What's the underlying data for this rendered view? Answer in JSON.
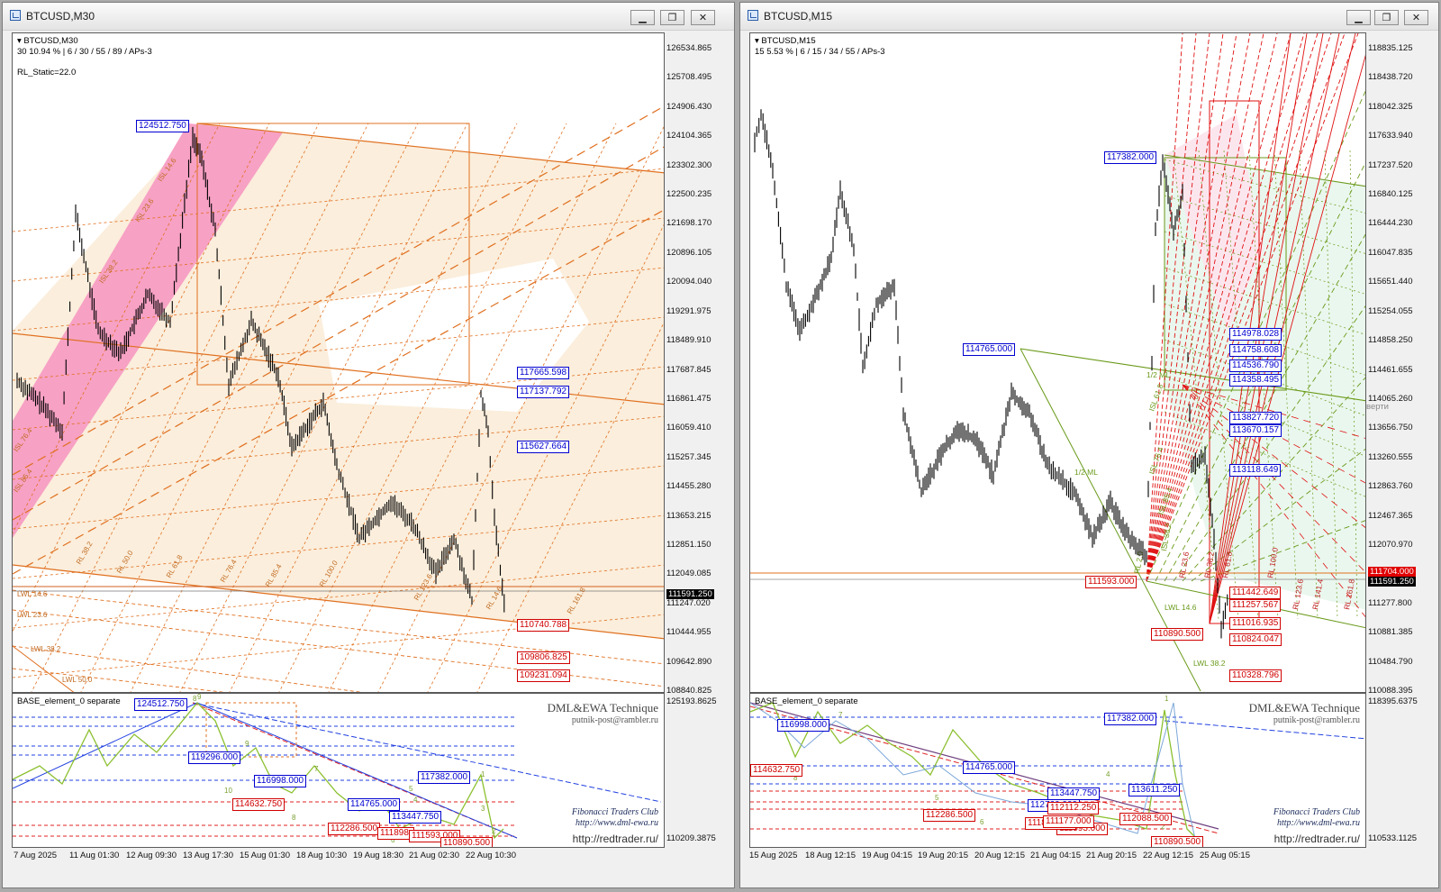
{
  "left": {
    "title": "BTCUSD,M30",
    "chart_label": "BTCUSD,M30",
    "info": "30  10.94 %  | 6 / 30 / 55 / 89 / APs-3",
    "static": "RL_Static=22.0",
    "y_ticks": [
      "126534.865",
      "125708.495",
      "124906.430",
      "124104.365",
      "123302.300",
      "122500.235",
      "121698.170",
      "120896.105",
      "120094.040",
      "119291.975",
      "118489.910",
      "117687.845",
      "116861.475",
      "116059.410",
      "115257.345",
      "114455.280",
      "113653.215",
      "112851.150",
      "112049.085",
      "111247.020",
      "110444.955",
      "109642.890",
      "108840.825"
    ],
    "bid_price": "111591.250",
    "price_tags": [
      {
        "text": "124512.750",
        "color": "blue"
      },
      {
        "text": "117665.598",
        "color": "blue"
      },
      {
        "text": "117137.792",
        "color": "blue"
      },
      {
        "text": "115627.664",
        "color": "blue"
      },
      {
        "text": "110740.788",
        "color": "red"
      },
      {
        "text": "109806.825",
        "color": "red"
      },
      {
        "text": "109231.094",
        "color": "red"
      }
    ],
    "fib_labels": [
      "ISL 14.6",
      "ISL 23.6",
      "ISL 38.2",
      "ISL 76.4",
      "ISL 85.4",
      "RL 38.2",
      "RL 50.0",
      "RL 61.8",
      "RL 76.4",
      "RL 85.4",
      "RL 100.0",
      "RL 123.6",
      "RL 161.8",
      "RL 14.6",
      "LWL 14.6",
      "LWL 23.6",
      "LWL 38.2",
      "LWL 50.0"
    ],
    "sub": {
      "title": "BASE_element_0 separate",
      "y_top": "125193.8625",
      "y_bottom": "110209.3875",
      "tags": [
        {
          "text": "124512.750",
          "color": "blue"
        },
        {
          "text": "119296.000",
          "color": "blue"
        },
        {
          "text": "116998.000",
          "color": "blue"
        },
        {
          "text": "117382.000",
          "color": "blue"
        },
        {
          "text": "114765.000",
          "color": "blue"
        },
        {
          "text": "113447.750",
          "color": "blue"
        },
        {
          "text": "114632.750",
          "color": "red"
        },
        {
          "text": "112286.500",
          "color": "red"
        },
        {
          "text": "111898.",
          "color": "red"
        },
        {
          "text": "111593.000",
          "color": "red"
        },
        {
          "text": "110890.500",
          "color": "red"
        }
      ],
      "wave_numbers": [
        "8",
        "9",
        "10",
        "7",
        "8",
        "5",
        "6",
        "4",
        "3",
        "2",
        "1",
        "9"
      ]
    },
    "x_ticks": [
      "7 Aug 2025",
      "11 Aug 01:30",
      "12 Aug 09:30",
      "13 Aug 17:30",
      "15 Aug 01:30",
      "18 Aug 10:30",
      "19 Aug 18:30",
      "21 Aug 02:30",
      "22 Aug 10:30"
    ],
    "watermark": {
      "title": "DML&EWA Technique",
      "email": "putnik-post@rambler.ru"
    },
    "club": {
      "name": "Fibonacci Traders Club",
      "site": "http://www.dml-ewa.ru"
    },
    "redtrader": "http://redtrader.ru/"
  },
  "right": {
    "title": "BTCUSD,M15",
    "chart_label": "BTCUSD,M15",
    "info": "15  5.53 %  | 6 / 15 / 34 / 55 / APs-3",
    "y_ticks": [
      "118835.125",
      "118438.720",
      "118042.325",
      "117633.940",
      "117237.520",
      "116840.125",
      "116444.230",
      "116047.835",
      "115651.440",
      "115254.055",
      "114858.250",
      "114461.655",
      "114065.260",
      "113656.750",
      "113260.555",
      "112863.760",
      "112467.365",
      "112070.970",
      "111674.575",
      "111277.800",
      "110881.385",
      "110484.790",
      "110088.395"
    ],
    "ask_price": "111704.000",
    "bid_price": "111591.250",
    "vert_label": "верти",
    "price_tags": [
      {
        "text": "117382.000",
        "color": "blue"
      },
      {
        "text": "114765.000",
        "color": "blue"
      },
      {
        "text": "114978.028",
        "color": "blue"
      },
      {
        "text": "114758.608",
        "color": "blue"
      },
      {
        "text": "114536.790",
        "color": "blue"
      },
      {
        "text": "114358.495",
        "color": "blue"
      },
      {
        "text": "113827.720",
        "color": "blue"
      },
      {
        "text": "113670.157",
        "color": "blue"
      },
      {
        "text": "113118.649",
        "color": "blue"
      },
      {
        "text": "111593.000",
        "color": "red"
      },
      {
        "text": "111442.649",
        "color": "red"
      },
      {
        "text": "111257.567",
        "color": "red"
      },
      {
        "text": "111016.935",
        "color": "red"
      },
      {
        "text": "110890.500",
        "color": "red"
      },
      {
        "text": "110824.047",
        "color": "red"
      },
      {
        "text": "110328.796",
        "color": "red"
      }
    ],
    "fib_labels": [
      "1/2 ML",
      "1/2 ML",
      "ISL 61.8",
      "ISL 76.4",
      "ISL 85.4",
      "ISL 38.2",
      "RL 23.6",
      "RL 38.2",
      "RL 61.8",
      "RL 100.0",
      "RL 123.6",
      "RL 141.4",
      "RL 161.8",
      "LWL 14.6",
      "LWL 38.2",
      "RL 2.0"
    ],
    "sub": {
      "title": "BASE_element_0 separate",
      "y_top": "118395.6375",
      "y_bottom": "110533.1125",
      "tags": [
        {
          "text": "117382.000",
          "color": "blue"
        },
        {
          "text": "116998.000",
          "color": "blue"
        },
        {
          "text": "114765.000",
          "color": "blue"
        },
        {
          "text": "113611.250",
          "color": "blue"
        },
        {
          "text": "112760.000",
          "color": "blue"
        },
        {
          "text": "113447.750",
          "color": "blue"
        },
        {
          "text": "114632.750",
          "color": "red"
        },
        {
          "text": "112286.500",
          "color": "red"
        },
        {
          "text": "111593.000",
          "color": "red"
        },
        {
          "text": "110890.500",
          "color": "red"
        },
        {
          "text": "111898.750",
          "color": "red"
        },
        {
          "text": "111177.000",
          "color": "red"
        },
        {
          "text": "112088.500",
          "color": "red"
        },
        {
          "text": "112112.250",
          "color": "red"
        }
      ],
      "wave_numbers": [
        "7",
        "8",
        "6",
        "5",
        "4",
        "3",
        "2",
        "1"
      ]
    },
    "x_ticks": [
      "15 Aug 2025",
      "18 Aug 12:15",
      "19 Aug 04:15",
      "19 Aug 20:15",
      "20 Aug 12:15",
      "21 Aug 04:15",
      "21 Aug 20:15",
      "22 Aug 12:15",
      "25 Aug 05:15"
    ],
    "watermark": {
      "title": "DML&EWA Technique",
      "email": "putnik-post@rambler.ru"
    },
    "club": {
      "name": "Fibonacci Traders Club",
      "site": "http://www.dml-ewa.ru"
    },
    "redtrader": "http://redtrader.ru/"
  },
  "colors": {
    "orange": "#e07020",
    "pink": "#f7a1c4",
    "peach": "#fbeedc",
    "blue_tag": "#0000d0",
    "red_tag": "#d00000",
    "green": "#6a9a1a"
  }
}
